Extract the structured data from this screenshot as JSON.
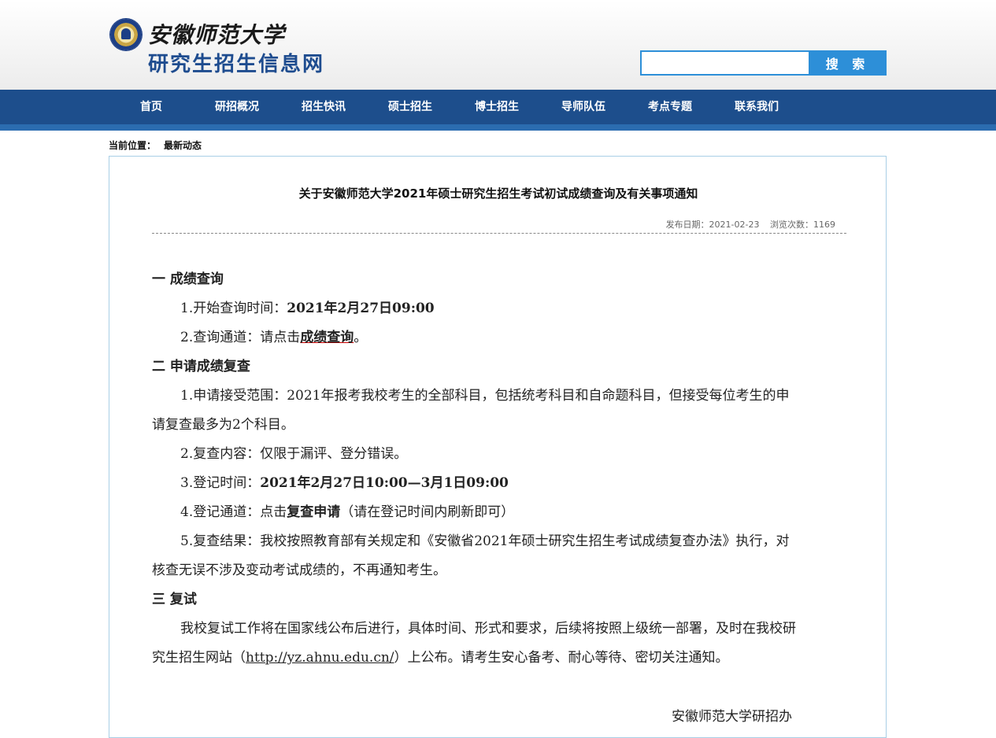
{
  "header": {
    "university_name": "安徽师范大学",
    "site_name": "研究生招生信息网",
    "search_placeholder": "",
    "search_button": "搜 索"
  },
  "nav": [
    {
      "label": "首页"
    },
    {
      "label": "研招概况"
    },
    {
      "label": "招生快讯"
    },
    {
      "label": "硕士招生"
    },
    {
      "label": "博士招生"
    },
    {
      "label": "导师队伍"
    },
    {
      "label": "考点专题"
    },
    {
      "label": "联系我们"
    }
  ],
  "breadcrumb": {
    "label": "当前位置：",
    "current": "最新动态"
  },
  "article": {
    "title": "关于安徽师范大学2021年硕士研究生招生考试初试成绩查询及有关事项通知",
    "date": "发布日期：2021-02-23",
    "views": "浏览次数：1169",
    "section1_title": "一  成绩查询",
    "s1_item1_prefix": "1.开始查询时间：",
    "s1_item1_value": "2021年2月27日09:00",
    "s1_item2_prefix": "2.查询通道：请点击",
    "s1_item2_link": "成绩查询",
    "s1_item2_suffix": "。",
    "section2_title": "二  申请成绩复查",
    "s2_item1": "1.申请接受范围：2021年报考我校考生的全部科目，包括统考科目和自命题科目，但接受每位考生的申请复查最多为2个科目。",
    "s2_item2": "2.复查内容：仅限于漏评、登分错误。",
    "s2_item3_prefix": "3.登记时间：",
    "s2_item3_value": "2021年2月27日10:00—3月1日09:00",
    "s2_item4_prefix": "4.登记通道：点击",
    "s2_item4_link": "复查申请",
    "s2_item4_suffix": "（请在登记时间内刷新即可）",
    "s2_item5": "5.复查结果：我校按照教育部有关规定和《安徽省2021年硕士研究生招生考试成绩复查办法》执行，对核查无误不涉及变动考试成绩的，不再通知考生。",
    "section3_title": "三  复试",
    "s3_para_prefix": "我校复试工作将在国家线公布后进行，具体时间、形式和要求，后续将按照上级统一部署，及时在我校研究生招生网站（",
    "s3_para_url": "http://yz.ahnu.edu.cn/",
    "s3_para_suffix": "）上公布。请考生安心备考、耐心等待、密切关注通知。",
    "signature": "安徽师范大学研招办"
  }
}
